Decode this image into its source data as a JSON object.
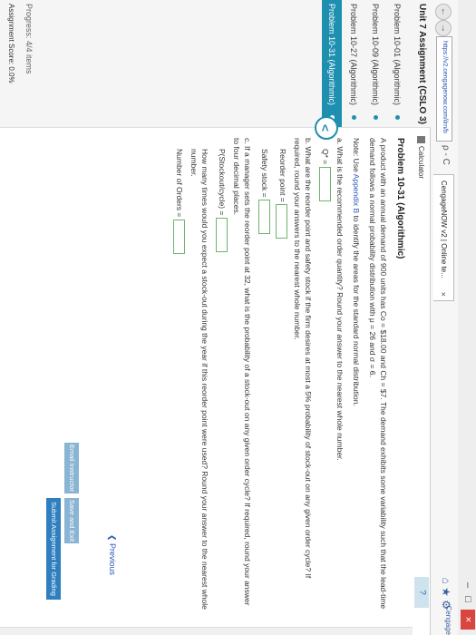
{
  "browser": {
    "url": "https://v2.cengagenow.com/ilrn/b",
    "tab_title": "CengageNOW v2 | Online te...",
    "tab_close": "×",
    "back_glyph": "←",
    "forward_glyph": "→",
    "url_icons": "ρ - C",
    "window_minimize": "–",
    "window_restore": "□",
    "window_close": "×",
    "right_icons": "⌂ ★ ⚙",
    "corner_tab": "Cengage"
  },
  "sidebar": {
    "unit_title": "Unit 7 Assignment (CSLO 3)",
    "items": [
      {
        "label": "Problem 10-01 (Algorithmic)",
        "active": false
      },
      {
        "label": "Problem 10-09 (Algorithmic)",
        "active": false
      },
      {
        "label": "Problem 10-27 (Algorithmic)",
        "active": false
      },
      {
        "label": "Problem 10-31 (Algorithmic)",
        "active": true
      }
    ],
    "progress": "Progress: 4/4 items",
    "score": "Assignment Score: 0.0%",
    "collapse_glyph": "<"
  },
  "toolbar": {
    "calculator_label": "Calculator"
  },
  "problem": {
    "title": "Problem 10-31 (Algorithmic)",
    "intro": "A product with an annual demand of 900 units has Co = $18.00 and Ch = $7. The demand exhibits some variability such that the lead-time demand follows a normal probability distribution with μ = 26 and σ = 6.",
    "note_prefix": "Note: Use ",
    "note_link": "Appendix B",
    "note_suffix": " to identify the areas for the standard normal distribution.",
    "part_a": "a. What is the recommended order quantity? Round your answer to the nearest whole number.",
    "qstar_label": "Q* =",
    "part_b": "b. What are the reorder point and safety stock if the firm desires at most a 5% probability of stock-out on any given order cycle? If required, round your answers to the nearest whole number.",
    "reorder_label": "Reorder point =",
    "safety_label": "Safety stock =",
    "part_c": "c. If a manager sets the reorder point at 32, what is the probability of a stock-out on any given order cycle? If required, round your answer to four decimal places.",
    "pstockout_label": "P(Stockout/cycle) =",
    "part_c2": "How many times would you expect a stock-out during the year if this reorder point were used? Round your answer to the nearest whole number.",
    "orders_label": "Number of Orders ="
  },
  "footer": {
    "previous": "❮ Previous",
    "email_instructor": "Email Instructor",
    "save_exit": "Save and Exit",
    "submit": "Submit Assignment for Grading"
  }
}
